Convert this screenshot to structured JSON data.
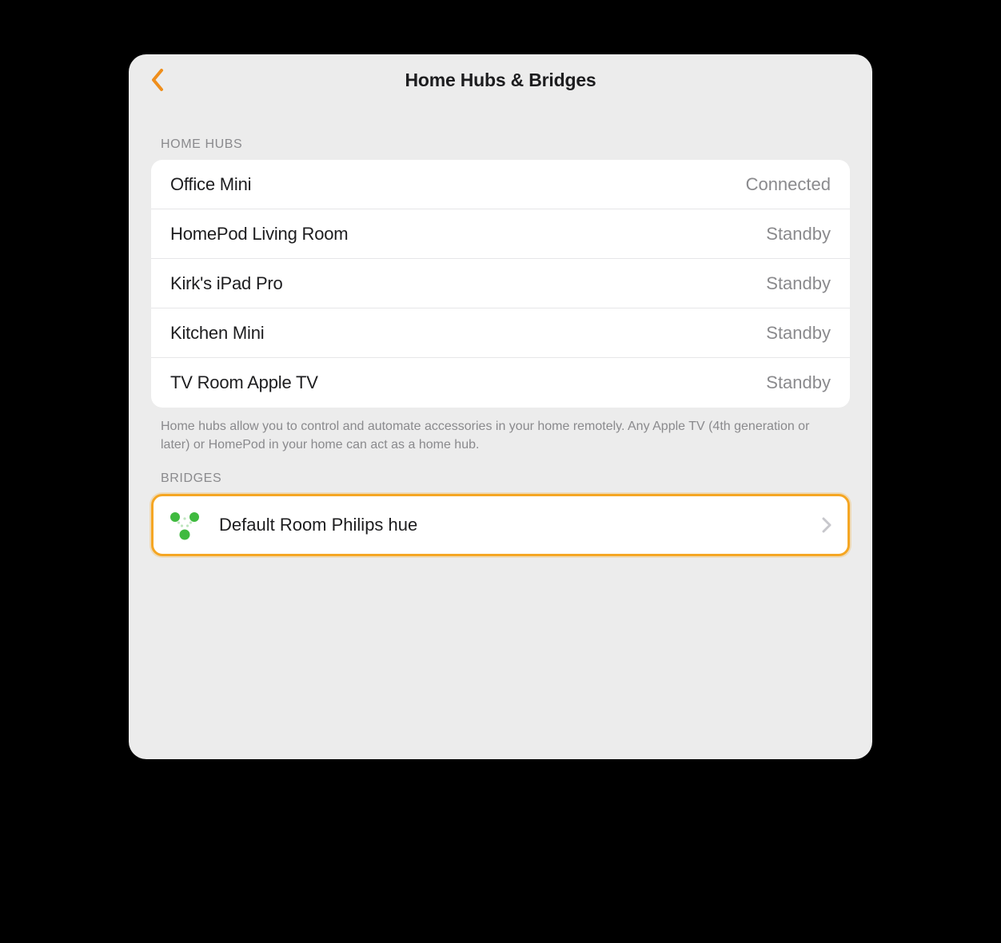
{
  "header": {
    "title": "Home Hubs & Bridges"
  },
  "sections": {
    "home_hubs": {
      "header": "HOME HUBS",
      "items": [
        {
          "name": "Office Mini",
          "status": "Connected"
        },
        {
          "name": "HomePod Living Room",
          "status": "Standby"
        },
        {
          "name": "Kirk's iPad Pro",
          "status": "Standby"
        },
        {
          "name": "Kitchen Mini",
          "status": "Standby"
        },
        {
          "name": "TV Room Apple TV",
          "status": "Standby"
        }
      ],
      "footer": "Home hubs allow you to control and automate accessories in your home remotely. Any Apple TV (4th generation or later) or HomePod in your home can act as a home hub."
    },
    "bridges": {
      "header": "BRIDGES",
      "items": [
        {
          "name": "Default Room Philips hue",
          "icon": "hue-bridge"
        }
      ]
    }
  },
  "colors": {
    "accent": "#ef8e1b",
    "highlight_border": "#f5a623",
    "hue_green": "#3fba3f"
  }
}
